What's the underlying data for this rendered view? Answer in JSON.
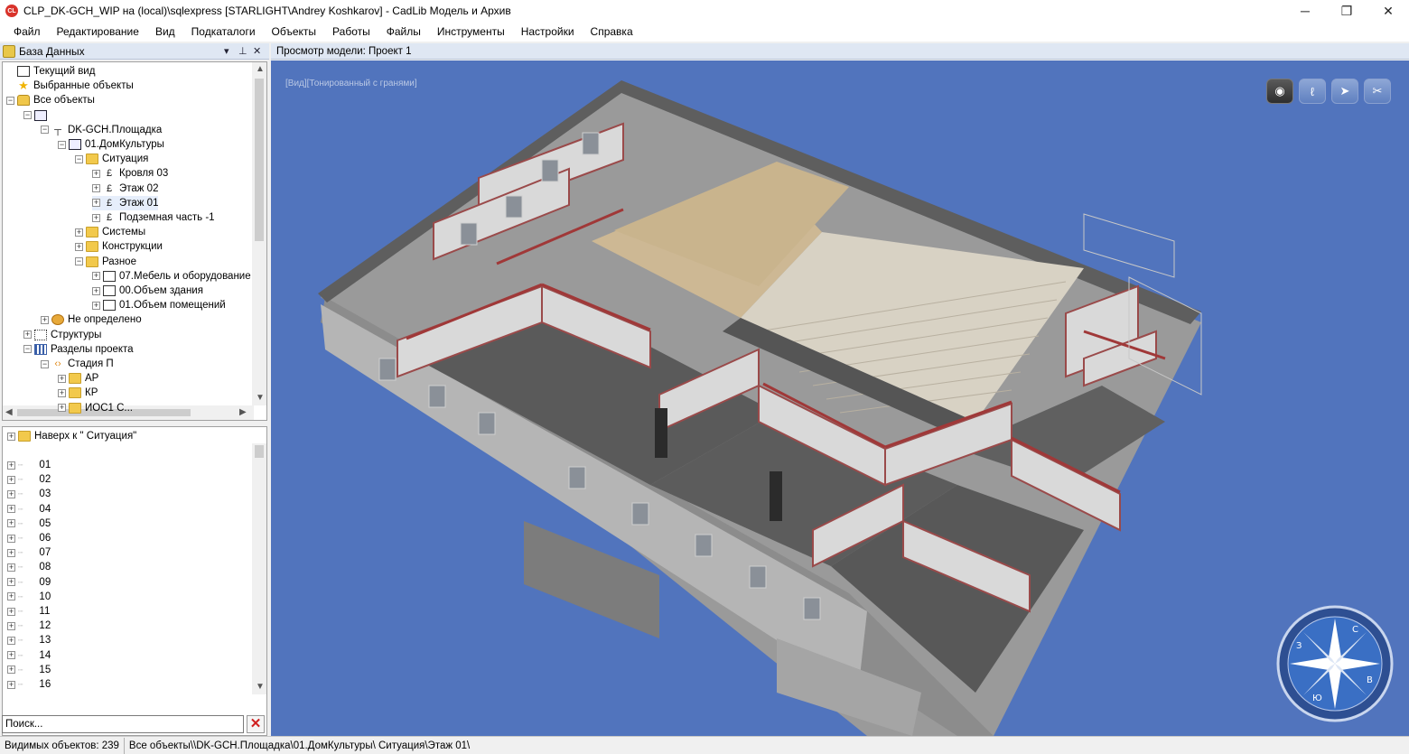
{
  "window": {
    "app_badge": "CL",
    "title": "CLP_DK-GCH_WIP на (local)\\sqlexpress [STARLIGHT\\Andrey Koshkarov] - CadLib Модель и Архив",
    "minimize": "─",
    "maximize": "❐",
    "close": "✕"
  },
  "menu": [
    "Файл",
    "Редактирование",
    "Вид",
    "Подкаталоги",
    "Объекты",
    "Работы",
    "Файлы",
    "Инструменты",
    "Настройки",
    "Справка"
  ],
  "db_panel": {
    "title": "База Данных",
    "controls": [
      "▾",
      "⊥",
      "✕"
    ],
    "tree": [
      {
        "label": "Текущий вид",
        "icon": "view",
        "indent": 0,
        "expander": ""
      },
      {
        "label": "Выбранные объекты",
        "icon": "star",
        "indent": 0,
        "expander": ""
      },
      {
        "label": "Все объекты",
        "icon": "db",
        "indent": 0,
        "expander": "−"
      },
      {
        "label": "",
        "icon": "bld",
        "indent": 1,
        "expander": "−"
      },
      {
        "label": "DK-GCH.Площадка",
        "icon": "site",
        "indent": 2,
        "expander": "−"
      },
      {
        "label": "01.ДомКультуры",
        "icon": "bld",
        "indent": 3,
        "expander": "−"
      },
      {
        "label": "Ситуация",
        "icon": "folder",
        "indent": 4,
        "expander": "−"
      },
      {
        "label": "Кровля 03",
        "icon": "lvl",
        "indent": 5,
        "expander": "+"
      },
      {
        "label": "Этаж 02",
        "icon": "lvl",
        "indent": 5,
        "expander": "+"
      },
      {
        "label": "Этаж 01",
        "icon": "lvl",
        "indent": 5,
        "expander": "+",
        "selected": true
      },
      {
        "label": "Подземная часть -1",
        "icon": "lvl",
        "indent": 5,
        "expander": "+"
      },
      {
        "label": "Системы",
        "icon": "folder",
        "indent": 4,
        "expander": "+"
      },
      {
        "label": "Конструкции",
        "icon": "folder",
        "indent": 4,
        "expander": "+"
      },
      {
        "label": "Разное",
        "icon": "folder",
        "indent": 4,
        "expander": "−"
      },
      {
        "label": "07.Мебель и оборудование",
        "icon": "box",
        "indent": 5,
        "expander": "+"
      },
      {
        "label": "00.Объем здания",
        "icon": "box",
        "indent": 5,
        "expander": "+"
      },
      {
        "label": "01.Объем помещений",
        "icon": "box",
        "indent": 5,
        "expander": "+"
      },
      {
        "label": "Не определено",
        "icon": "q",
        "indent": 2,
        "expander": "+"
      },
      {
        "label": "Структуры",
        "icon": "struct",
        "indent": 1,
        "expander": "+"
      },
      {
        "label": "Разделы проекта",
        "icon": "grid",
        "indent": 1,
        "expander": "−"
      },
      {
        "label": "Стадия П",
        "icon": "stage",
        "indent": 2,
        "expander": "−"
      },
      {
        "label": "АР",
        "icon": "folder",
        "indent": 3,
        "expander": "+"
      },
      {
        "label": "КР",
        "icon": "folder",
        "indent": 3,
        "expander": "+"
      },
      {
        "label": "ИОС1 С...",
        "icon": "folder",
        "indent": 3,
        "expander": "+"
      }
    ]
  },
  "list_panel": {
    "up_label": "Наверх к \" Ситуация\"",
    "items": [
      "01",
      "02",
      "03",
      "04",
      "05",
      "06",
      "07",
      "08",
      "09",
      "10",
      "11",
      "12",
      "13",
      "14",
      "15",
      "16"
    ]
  },
  "search": {
    "placeholder": "Поиск...",
    "clear": "✕"
  },
  "viewport": {
    "header": "Просмотр модели: Проект 1",
    "mode_label": "[Вид][Тонированный с гранями]",
    "nav_buttons": [
      {
        "icon": "eye-icon",
        "glyph": "◉",
        "active": true
      },
      {
        "icon": "walk-icon",
        "glyph": "ℓ",
        "active": false
      },
      {
        "icon": "fly-icon",
        "glyph": "➤",
        "active": false
      },
      {
        "icon": "tools-icon",
        "glyph": "✂",
        "active": false
      }
    ],
    "compass_letters": [
      "С",
      "В",
      "Ю",
      "З"
    ]
  },
  "status": {
    "visible_objects": "Видимых объектов: 239",
    "path": "Все объекты\\\\DK-GCH.Площадка\\01.ДомКультуры\\ Ситуация\\Этаж 01\\"
  }
}
